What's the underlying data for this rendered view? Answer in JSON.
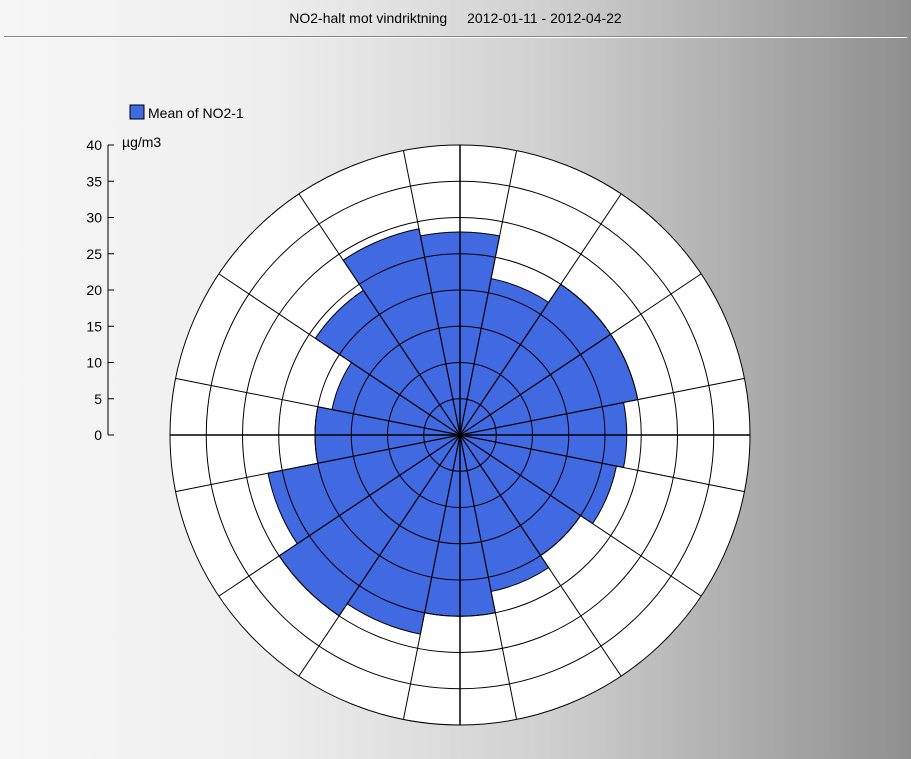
{
  "title": {
    "main": "NO2-halt mot vindriktning",
    "dates": "2012-01-11 - 2012-04-22"
  },
  "legend": {
    "series_label": "Mean of NO2-1"
  },
  "axis": {
    "unit": "µg/m3",
    "max": 40,
    "ticks": [
      0,
      5,
      10,
      15,
      20,
      25,
      30,
      35,
      40
    ]
  },
  "chart_data": {
    "type": "polar-bar",
    "title": "NO2-halt mot vindriktning",
    "subtitle": "2012-01-11 - 2012-04-22",
    "ylabel": "µg/m3",
    "ylim": [
      0,
      40
    ],
    "n_sectors": 16,
    "sector_start_deg": 0,
    "sector_width_deg": 22.5,
    "series": [
      {
        "name": "Mean of NO2-1",
        "direction_deg": [
          0,
          22.5,
          45,
          67.5,
          90,
          112.5,
          135,
          157.5,
          180,
          202.5,
          225,
          247.5,
          270,
          292.5,
          315,
          337.5
        ],
        "values": [
          28,
          22,
          25,
          25,
          23,
          22,
          20,
          22,
          25,
          28,
          30,
          27,
          20,
          18,
          24,
          29
        ]
      }
    ],
    "legend": [
      "Mean of NO2-1"
    ],
    "grid": {
      "rings_at": [
        5,
        10,
        15,
        20,
        25,
        30,
        35,
        40
      ],
      "spokes": 16
    }
  }
}
